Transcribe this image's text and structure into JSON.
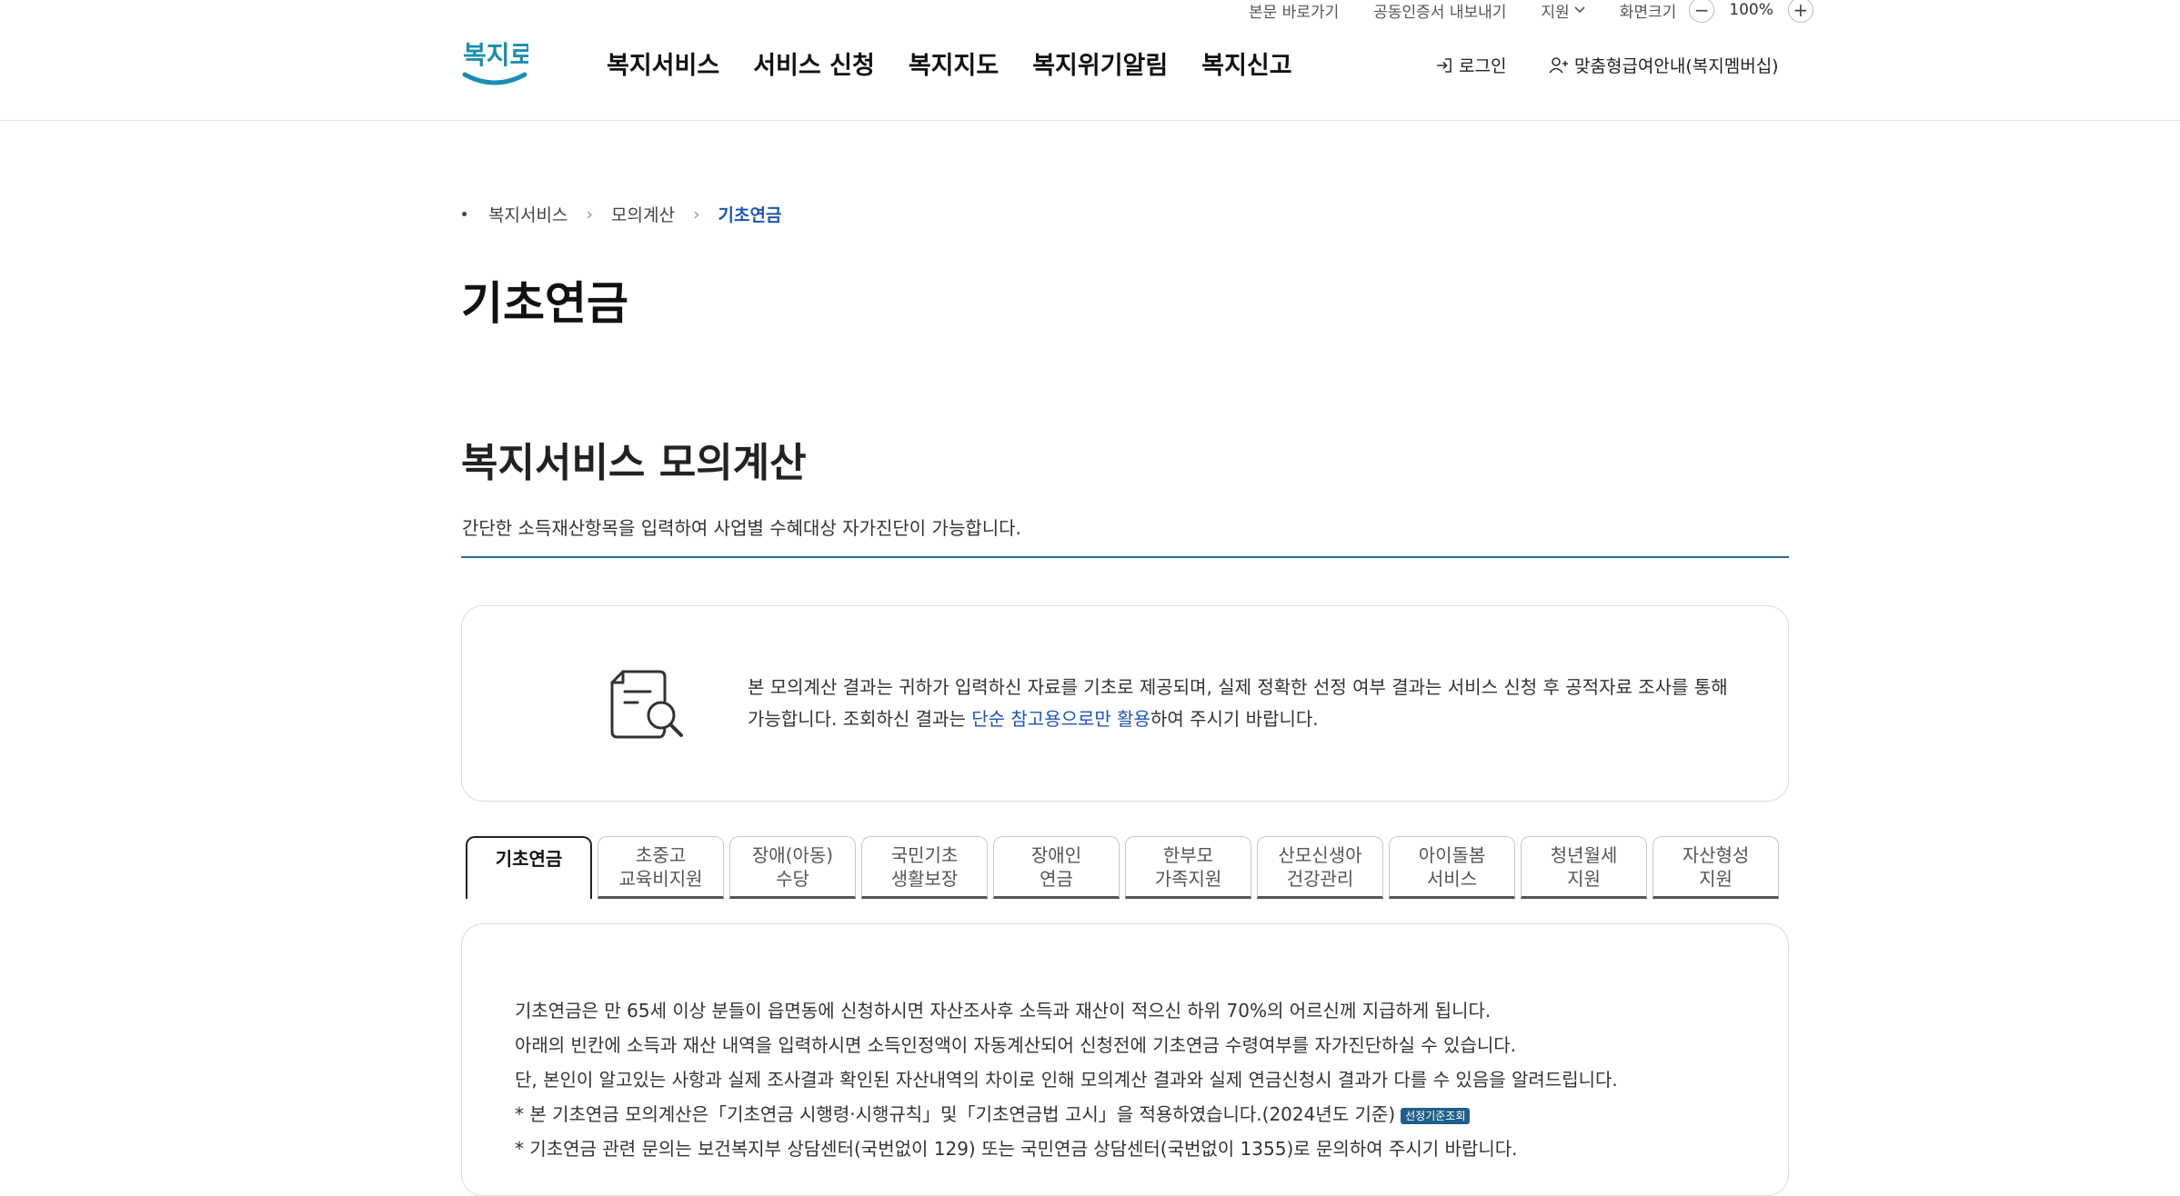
{
  "utility": {
    "skip_to_content": "본문 바로가기",
    "cert_export": "공동인증서 내보내기",
    "support": "지원",
    "zoom_label": "화면크기",
    "zoom_out": "−",
    "zoom_value": "100%",
    "zoom_in": "+"
  },
  "logo": {
    "text": "복지로"
  },
  "gnb": [
    {
      "label": "복지서비스"
    },
    {
      "label": "서비스 신청"
    },
    {
      "label": "복지지도"
    },
    {
      "label": "복지위기알림"
    },
    {
      "label": "복지신고"
    }
  ],
  "account": {
    "login": "로그인",
    "membership": "맞춤형급여안내(복지멤버십)"
  },
  "breadcrumb": [
    "복지서비스",
    "모의계산",
    "기초연금"
  ],
  "page_title": "기초연금",
  "section": {
    "title": "복지서비스 모의계산",
    "description": "간단한 소득재산항목을 입력하여 사업별 수혜대상 자가진단이 가능합니다."
  },
  "notice": {
    "text_before": "본 모의계산 결과는 귀하가 입력하신 자료를 기초로 제공되며, 실제 정확한 선정 여부 결과는 서비스 신청 후 공적자료 조사를 통해 가능합니다. 조회하신 결과는 ",
    "highlight": "단순 참고용으로만 활용",
    "text_after": "하여 주시기 바랍니다."
  },
  "tabs": [
    {
      "label": "기초연금",
      "active": true
    },
    {
      "label": "초중고\n교육비지원"
    },
    {
      "label": "장애(아동)\n수당"
    },
    {
      "label": "국민기초\n생활보장"
    },
    {
      "label": "장애인\n연금"
    },
    {
      "label": "한부모\n가족지원"
    },
    {
      "label": "산모신생아\n건강관리"
    },
    {
      "label": "아이돌봄\n서비스"
    },
    {
      "label": "청년월세\n지원"
    },
    {
      "label": "자산형성\n지원"
    }
  ],
  "content": {
    "line1": "기초연금은 만 65세 이상 분들이 읍면동에 신청하시면 자산조사후 소득과 재산이 적으신 하위 70%의 어르신께 지급하게 됩니다.",
    "line2": "아래의 빈칸에 소득과 재산 내역을 입력하시면 소득인정액이 자동계산되어 신청전에 기초연금 수령여부를 자가진단하실 수 있습니다.",
    "line3": "단, 본인이 알고있는 사항과 실제 조사결과 확인된 자산내역의 차이로 인해 모의계산 결과와 실제 연금신청시 결과가 다를 수 있음을 알려드립니다.",
    "line4": "* 본 기초연금 모의계산은「기초연금 시행령‧시행규칙」및「기초연금법 고시」을 적용하였습니다.(2024년도 기준)",
    "badge": "선정기준조회",
    "line5": "* 기초연금 관련 문의는 보건복지부 상담센터(국번없이 129) 또는 국민연금 상담센터(국번없이 1355)로 문의하여 주시기 바랍니다."
  },
  "colors": {
    "accent_blue": "#1d55b6",
    "rule_blue": "#2a6a9c",
    "badge_bg": "#1e5f8c",
    "logo_teal": "#1a8fb0"
  }
}
